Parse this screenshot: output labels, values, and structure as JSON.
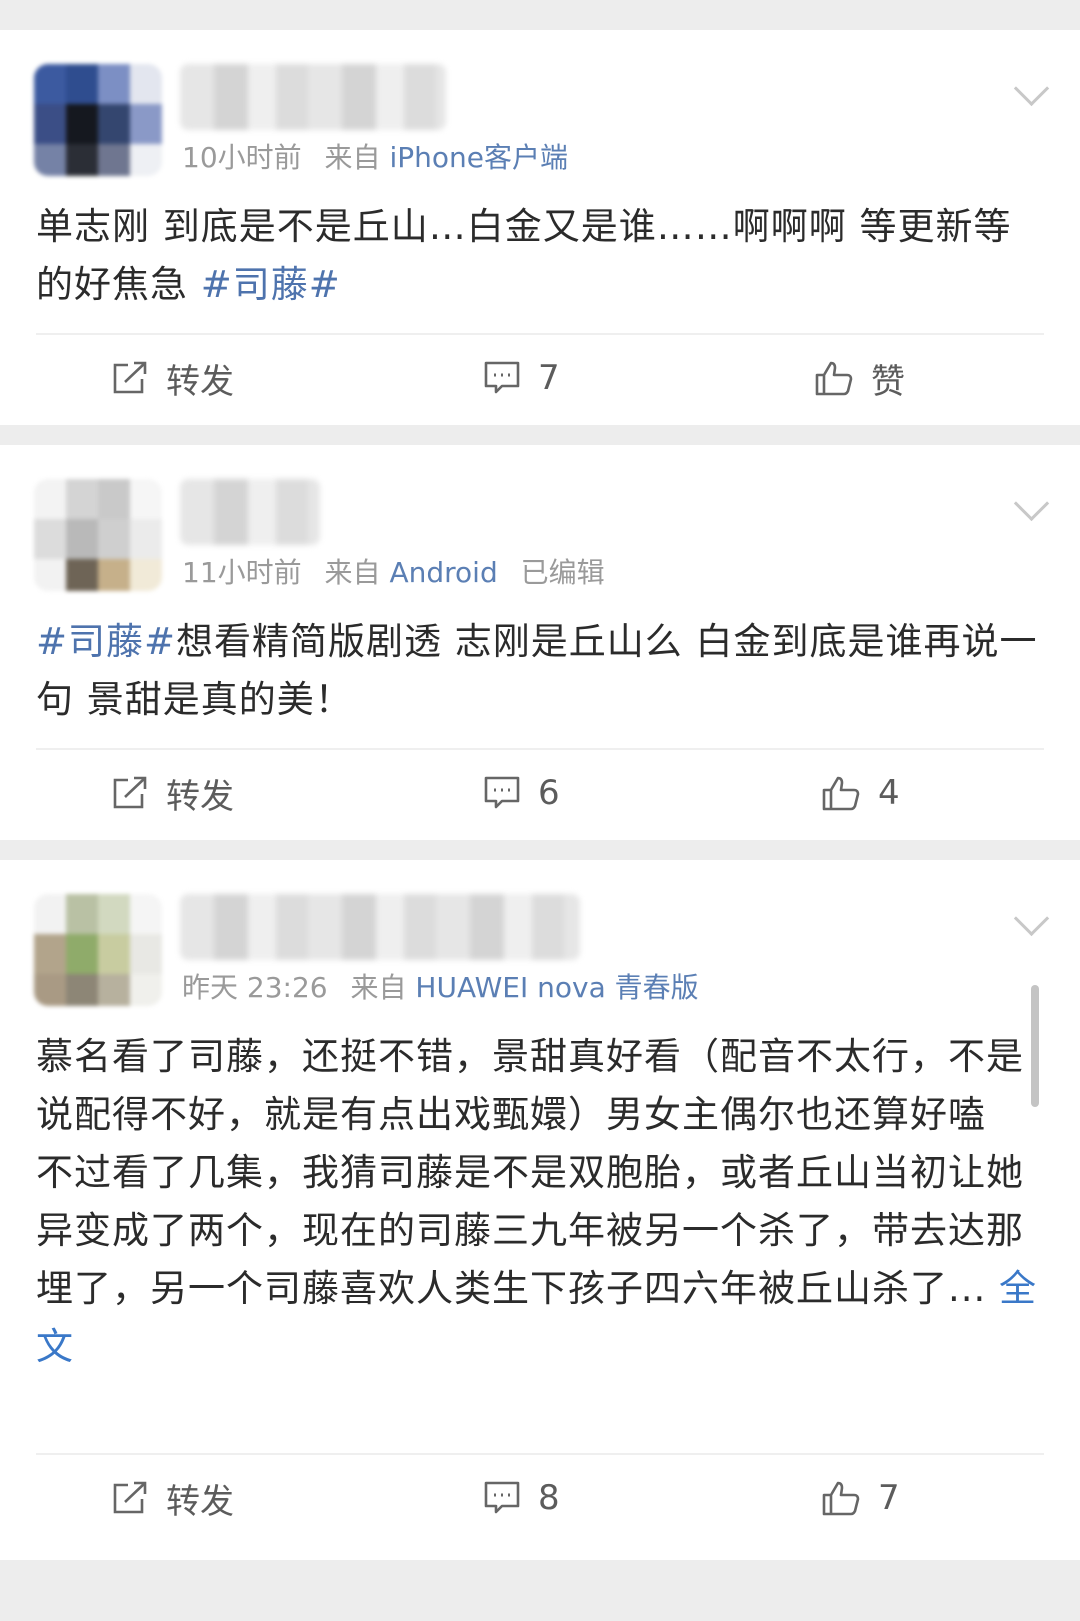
{
  "posts": [
    {
      "time": "10小时前",
      "from": "来自",
      "source": "iPhone客户端",
      "text_1": "单志刚 到底是不是丘山…白金又是谁……啊啊啊 等更新等的好焦急 ",
      "hashtag": "#司藤#",
      "actions": {
        "repost": "转发",
        "comment": "7",
        "like": "赞"
      }
    },
    {
      "time": "11小时前",
      "from": "来自",
      "source": "Android",
      "edited": "已编辑",
      "hashtag": "#司藤#",
      "text_1": "想看精简版剧透  志刚是丘山么  白金到底是谁再说一句  景甜是真的美！",
      "actions": {
        "repost": "转发",
        "comment": "6",
        "like": "4"
      }
    },
    {
      "time": "昨天 23:26",
      "from": "来自",
      "source": "HUAWEI nova 青春版",
      "text_1": "慕名看了司藤，还挺不错，景甜真好看（配音不太行，不是说配得不好，就是有点出戏甄嬛）男女主偶尔也还算好嗑",
      "text_2": "不过看了几集，我猜司藤是不是双胞胎，或者丘山当初让她异变成了两个，现在的司藤三九年被另一个杀了，带去达那埋了，另一个司藤喜欢人类生下孩子四六年被丘山杀了... ",
      "more": "全文",
      "actions": {
        "repost": "转发",
        "comment": "8",
        "like": "7"
      }
    }
  ],
  "colors": {
    "link": "#4e73ad",
    "meta": "#9a9a9a",
    "text": "#2b2b2b"
  }
}
